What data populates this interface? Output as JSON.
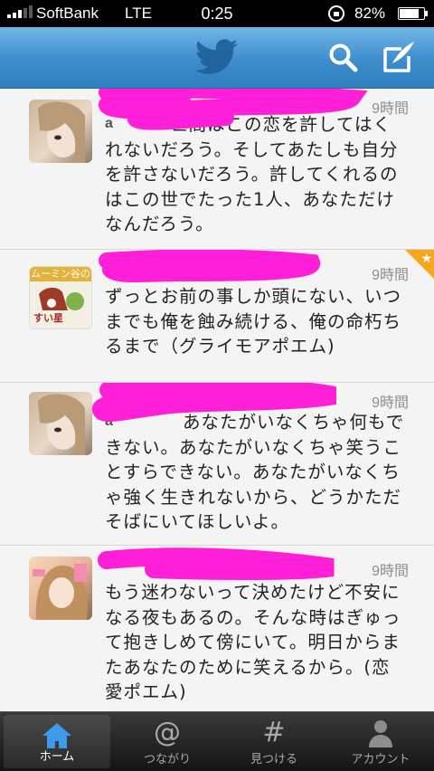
{
  "status_bar": {
    "carrier": "SoftBank",
    "network": "LTE",
    "time": "0:25",
    "battery": "82%",
    "battery_level": 0.82
  },
  "nav": {
    "logo_icon": "twitter-bird-icon",
    "search_icon": "search-icon",
    "compose_icon": "compose-icon",
    "bar_color": "#3d8dcc"
  },
  "tweets": [
    {
      "time": "9時間",
      "name_fragment": "a",
      "text": "世間はこの恋を許してはくれないだろう。そしてあたしも自分を許さないだろう。許してくれるのはこの世でたった1人、あなただけなんだろう。",
      "favorited": false
    },
    {
      "time": "9時間",
      "name_fragment": "",
      "avatar_text_top": "ムーミン谷の",
      "avatar_text_bottom": "すい星",
      "text": "ずっとお前の事しか頭にない、いつまでも俺を蝕み続ける、俺の命朽ちるまで（グライモアポエム)",
      "favorited": true
    },
    {
      "time": "9時間",
      "name_fragment": "a",
      "text": "あなたがいなくちゃ何もできない。あなたがいなくちゃ笑うことすらできない。あなたがいなくちゃ強く生きれないから、どうかただそばにいてほしいよ。",
      "favorited": false
    },
    {
      "time": "9時間",
      "name_fragment": "",
      "text": "もう迷わないって決めたけど不安になる夜もあるの。そんな時はぎゅって抱きしめて傍にいて。明日からまたあなたのために笑えるから。(恋愛ポエム)",
      "favorited": false
    }
  ],
  "tab_bar": {
    "home": "ホーム",
    "connect": "つながり",
    "discover": "見つける",
    "account": "アカウント",
    "connect_glyph": "@",
    "discover_glyph": "#"
  },
  "colors": {
    "redaction": "#ff1fd8",
    "favorite": "#f5a623",
    "active_tab_icon": "#3d9be9"
  }
}
